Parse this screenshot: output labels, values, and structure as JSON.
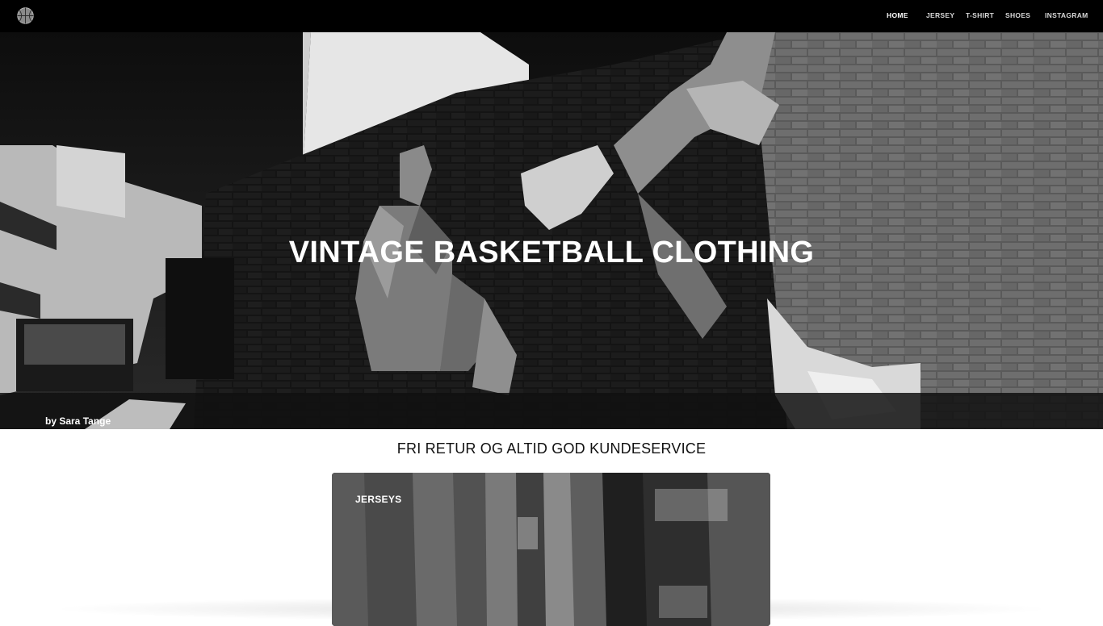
{
  "nav": {
    "items": [
      {
        "label": "HOME",
        "active": true
      },
      {
        "label": "JERSEY",
        "active": false
      },
      {
        "label": "T-SHIRT",
        "active": false
      },
      {
        "label": "SHOES",
        "active": false
      },
      {
        "label": "INSTAGRAM",
        "active": false
      }
    ],
    "logo_icon": "basketball-icon"
  },
  "hero": {
    "title": "VINTAGE BASKETBALL CLOTHING",
    "credit": "by Sara Tange"
  },
  "tagline": "FRI RETUR OG ALTID GOD KUNDESERVICE",
  "categories": [
    {
      "label": "JERSEYS"
    }
  ],
  "colors": {
    "topbar": "#000000",
    "page_background": "#ffffff",
    "text_light": "#ffffff",
    "text_dark": "#111111"
  }
}
